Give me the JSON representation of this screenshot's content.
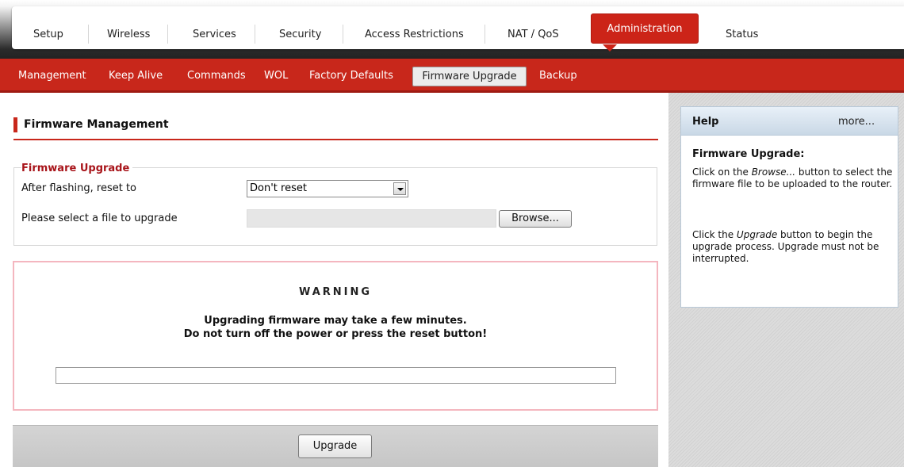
{
  "top_nav": {
    "tabs": [
      {
        "label": "Setup"
      },
      {
        "label": "Wireless"
      },
      {
        "label": "Services"
      },
      {
        "label": "Security"
      },
      {
        "label": "Access Restrictions"
      },
      {
        "label": "NAT / QoS"
      },
      {
        "label": "Administration",
        "active": true
      },
      {
        "label": "Status"
      }
    ]
  },
  "sub_nav": {
    "items": [
      {
        "label": "Management"
      },
      {
        "label": "Keep Alive"
      },
      {
        "label": "Commands"
      },
      {
        "label": "WOL"
      },
      {
        "label": "Factory Defaults"
      },
      {
        "label": "Firmware Upgrade",
        "active": true
      },
      {
        "label": "Backup"
      }
    ]
  },
  "main": {
    "section_title": "Firmware Management",
    "fieldset": {
      "legend": "Firmware Upgrade",
      "reset_label": "After flashing, reset to",
      "reset_value": "Don't reset",
      "file_label": "Please select a file to upgrade",
      "browse_label": "Browse..."
    },
    "warning": {
      "title": "WARNING",
      "line1": "Upgrading firmware may take a few minutes.",
      "line2": "Do not turn off the power or press the reset button!",
      "progress": 0
    },
    "upgrade_label": "Upgrade"
  },
  "help": {
    "title": "Help",
    "more": "more...",
    "subtitle": "Firmware Upgrade:",
    "p1_a": "Click on the ",
    "p1_em": "Browse...",
    "p1_b": " button to select the firmware file to be uploaded to the router.",
    "p2_a": "Click the ",
    "p2_em": "Upgrade",
    "p2_b": " button to begin the upgrade process. Upgrade must not be interrupted."
  },
  "colors": {
    "brand_red": "#c8271b",
    "warning_border": "#f4b6bf",
    "help_header": "#c9d8e6"
  }
}
